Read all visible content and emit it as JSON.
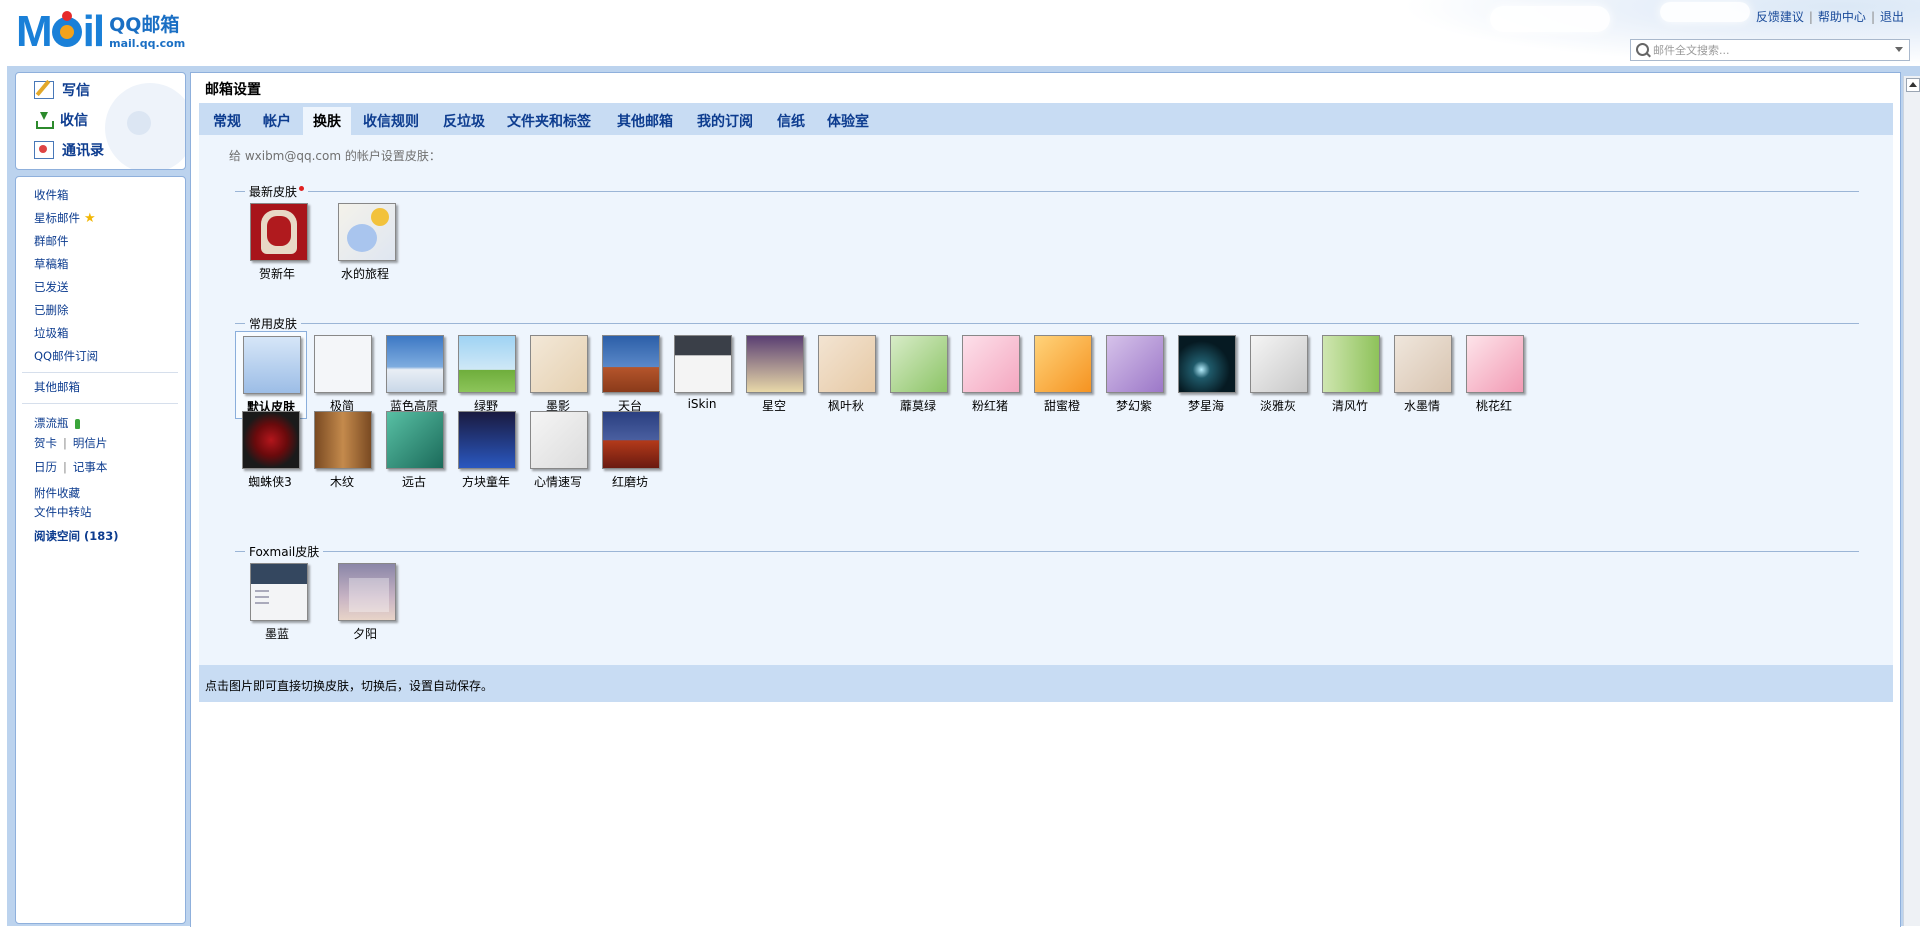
{
  "header": {
    "logo_text": "M",
    "logo_text2": "il",
    "brand_cn": "QQ邮箱",
    "brand_en": "mail.qq.com",
    "links": [
      "反馈建议",
      "帮助中心",
      "退出"
    ],
    "search_placeholder": "邮件全文搜索..."
  },
  "sidebar": {
    "actions": [
      {
        "label": "写信",
        "icon": "compose-icon"
      },
      {
        "label": "收信",
        "icon": "inbox-download-icon"
      },
      {
        "label": "通讯录",
        "icon": "contacts-icon"
      }
    ],
    "folders": [
      "收件箱",
      "星标邮件",
      "群邮件",
      "草稿箱",
      "已发送",
      "已删除",
      "垃圾箱",
      "QQ邮件订阅"
    ],
    "other_mail": "其他邮箱",
    "bottle": "漂流瓶",
    "cards": "贺卡",
    "postcard": "明信片",
    "calendar": "日历",
    "notebook": "记事本",
    "attachments": "附件收藏",
    "transfer": "文件中转站",
    "reading": "阅读空间 (183)"
  },
  "main": {
    "title": "邮箱设置",
    "tabs": [
      "常规",
      "帐户",
      "换肤",
      "收信规则",
      "反垃圾",
      "文件夹和标签",
      "其他邮箱",
      "我的订阅",
      "信纸",
      "体验室"
    ],
    "active_tab": "换肤",
    "intro": "给 wxibm@qq.com 的帐户设置皮肤：",
    "sections": {
      "newest": "最新皮肤",
      "common": "常用皮肤",
      "foxmail": "Foxmail皮肤"
    },
    "newest_skins": [
      "贺新年",
      "水的旅程"
    ],
    "common_skins": [
      "默认皮肤",
      "极简",
      "蓝色高原",
      "绿野",
      "墨影",
      "天台",
      "iSkin",
      "星空",
      "枫叶秋",
      "蘼莫绿",
      "粉红猪",
      "甜蜜橙",
      "梦幻紫",
      "梦星海",
      "淡雅灰",
      "清风竹",
      "水墨情",
      "桃花红",
      "蜘蛛侠3",
      "木纹",
      "远古",
      "方块童年",
      "心情速写",
      "红磨坊"
    ],
    "foxmail_skins": [
      "墨蓝",
      "夕阳"
    ],
    "footer": "点击图片即可直接切换皮肤，切换后，设置自动保存。"
  }
}
